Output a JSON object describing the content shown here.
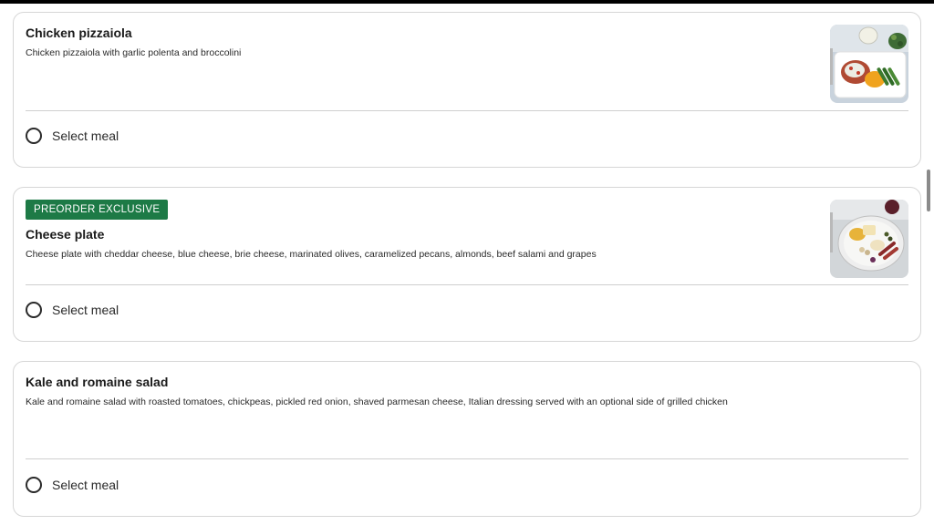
{
  "meals": [
    {
      "title": "Chicken pizzaiola",
      "description": "Chicken pizzaiola with garlic polenta and broccolini",
      "select_label": "Select meal",
      "has_image": true
    },
    {
      "badge": "PREORDER EXCLUSIVE",
      "title": "Cheese plate",
      "description": "Cheese plate with cheddar cheese, blue cheese, brie cheese, marinated olives, caramelized pecans, almonds, beef salami and grapes",
      "select_label": "Select meal",
      "has_image": true
    },
    {
      "title": "Kale and romaine salad",
      "description": "Kale and romaine salad with roasted tomatoes, chickpeas, pickled red onion, shaved parmesan cheese, Italian dressing served with an optional side of grilled chicken",
      "select_label": "Select meal",
      "has_image": false
    }
  ],
  "colors": {
    "badge_bg": "#1d7a46",
    "card_border": "#d6d6d6",
    "divider": "#cfcfcf"
  }
}
